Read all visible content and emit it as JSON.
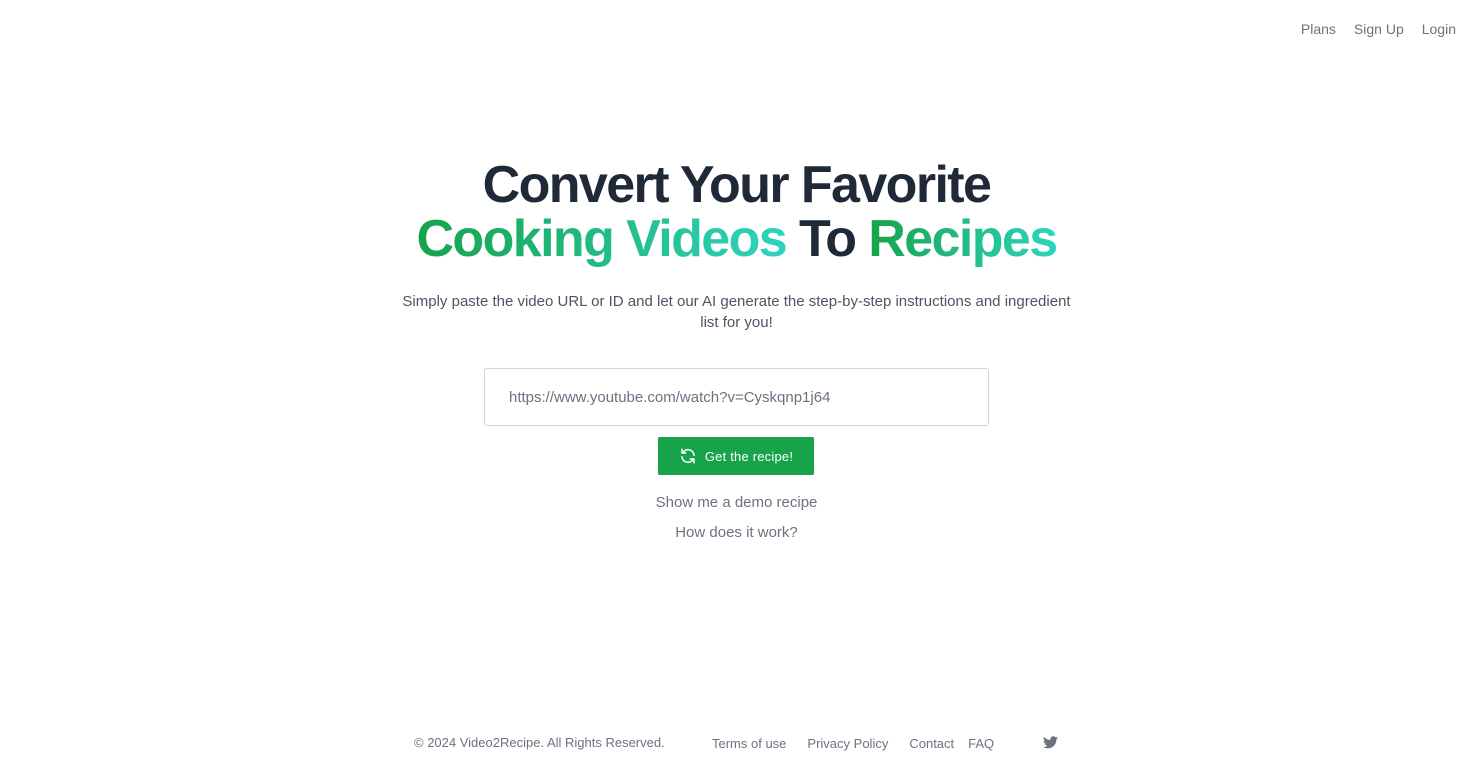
{
  "nav": {
    "plans": "Plans",
    "sign_up": "Sign Up",
    "login": "Login"
  },
  "hero": {
    "line1": "Convert Your Favorite",
    "line2_part1": "Cooking Videos",
    "line2_part2": "To",
    "line2_part3": "Recipes",
    "subtitle": "Simply paste the video URL or ID and let our AI generate the step-by-step instructions and ingredient list for you!"
  },
  "form": {
    "url_value": "https://www.youtube.com/watch?v=Cyskqnp1j64",
    "submit_label": "Get the recipe!"
  },
  "links": {
    "demo": "Show me a demo recipe",
    "how": "How does it work?"
  },
  "footer": {
    "copyright": "© 2024 Video2Recipe. All Rights Reserved.",
    "terms": "Terms of use",
    "privacy": "Privacy Policy",
    "contact": "Contact",
    "faq": "FAQ",
    "social_icon": "twitter-icon"
  },
  "colors": {
    "accent": "#16a34a",
    "accent_light": "#2dd4bf",
    "heading": "#1f2937",
    "muted": "#6b7280"
  }
}
